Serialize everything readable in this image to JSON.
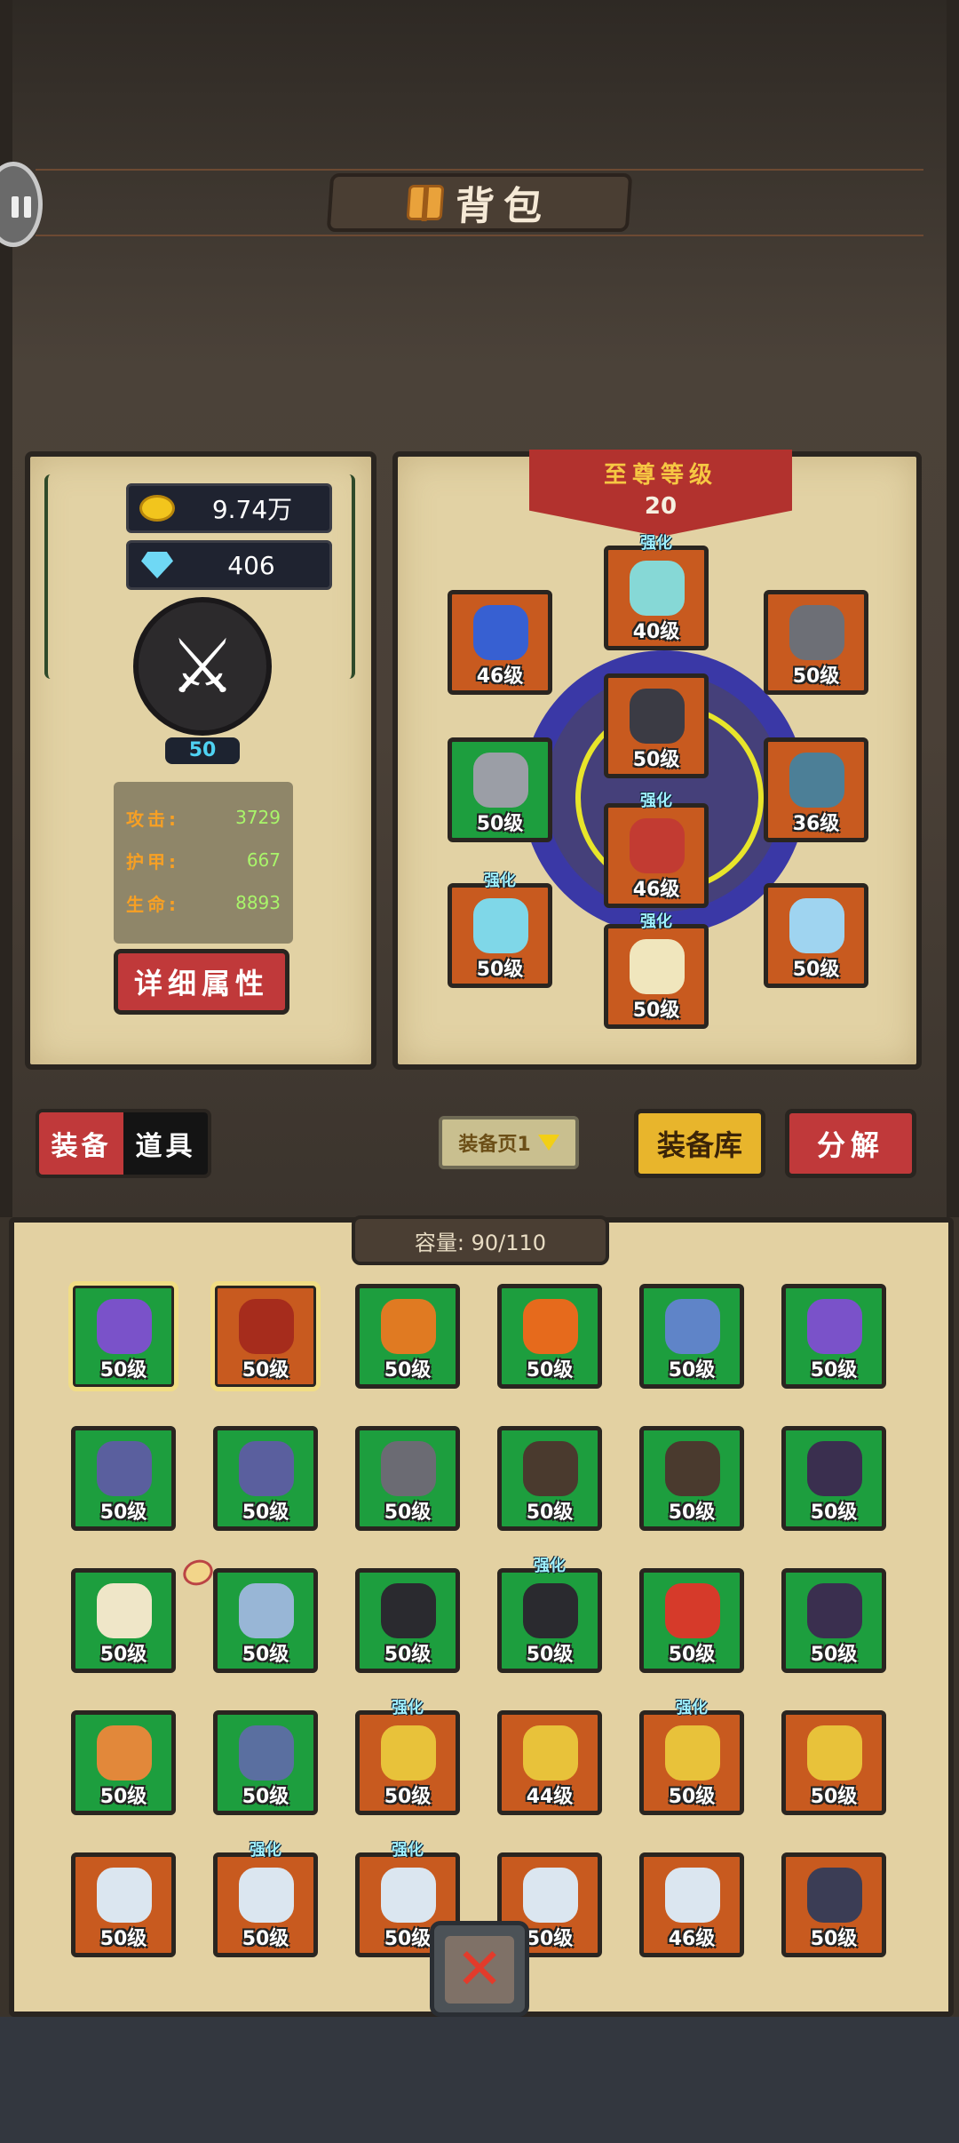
{
  "header": {
    "title": "背包"
  },
  "currency": {
    "gold": "9.74万",
    "gems": "406"
  },
  "hero": {
    "level": "50",
    "stats": [
      {
        "label": "攻击:",
        "value": "3729"
      },
      {
        "label": "护甲:",
        "value": "667"
      },
      {
        "label": "生命:",
        "value": "8893"
      }
    ],
    "detail_button": "详细属性"
  },
  "rank": {
    "title": "至尊等级",
    "level": "20"
  },
  "enhanced_label": "强化",
  "equipped": [
    {
      "slot": "helmet",
      "level": "40级",
      "color": "orange",
      "enhanced": true,
      "icon_color": "#86d8d6"
    },
    {
      "slot": "ring-left",
      "level": "46级",
      "color": "orange",
      "enhanced": false,
      "icon_color": "#3760d2"
    },
    {
      "slot": "necklace",
      "level": "50级",
      "color": "orange",
      "enhanced": false,
      "icon_color": "#6d6f76"
    },
    {
      "slot": "armor",
      "level": "50级",
      "color": "orange",
      "enhanced": false,
      "icon_color": "#3b3b44"
    },
    {
      "slot": "gloves",
      "level": "50级",
      "color": "green",
      "enhanced": false,
      "icon_color": "#9b9ea6"
    },
    {
      "slot": "bracelet",
      "level": "36级",
      "color": "orange",
      "enhanced": false,
      "icon_color": "#4c7f97"
    },
    {
      "slot": "belt",
      "level": "46级",
      "color": "orange",
      "enhanced": true,
      "icon_color": "#c23b32"
    },
    {
      "slot": "weapon-left",
      "level": "50级",
      "color": "orange",
      "enhanced": true,
      "icon_color": "#7fd7e8"
    },
    {
      "slot": "weapon-right",
      "level": "50级",
      "color": "orange",
      "enhanced": false,
      "icon_color": "#9fd4f0"
    },
    {
      "slot": "boots",
      "level": "50级",
      "color": "orange",
      "enhanced": true,
      "icon_color": "#f0e6bd"
    }
  ],
  "tabs": {
    "equipment": "装备",
    "items": "道具"
  },
  "page_select": "装备页1",
  "buttons": {
    "warehouse": "装备库",
    "decompose": "分解"
  },
  "capacity": "容量: 90/110",
  "inventory": [
    {
      "level": "50级",
      "color": "green",
      "enhanced": false,
      "selected": true,
      "icon_color": "#7a52c9"
    },
    {
      "level": "50级",
      "color": "orange",
      "enhanced": false,
      "selected": true,
      "icon_color": "#a62c1c"
    },
    {
      "level": "50级",
      "color": "green",
      "enhanced": false,
      "selected": false,
      "icon_color": "#e07a22"
    },
    {
      "level": "50级",
      "color": "green",
      "enhanced": false,
      "selected": false,
      "icon_color": "#e66a1c"
    },
    {
      "level": "50级",
      "color": "green",
      "enhanced": false,
      "selected": false,
      "icon_color": "#5f84c8"
    },
    {
      "level": "50级",
      "color": "green",
      "enhanced": false,
      "selected": false,
      "icon_color": "#7a52c9"
    },
    {
      "level": "50级",
      "color": "green",
      "enhanced": false,
      "selected": false,
      "icon_color": "#5a5f9e"
    },
    {
      "level": "50级",
      "color": "green",
      "enhanced": false,
      "selected": false,
      "icon_color": "#5a5f9e"
    },
    {
      "level": "50级",
      "color": "green",
      "enhanced": false,
      "selected": false,
      "icon_color": "#6b6b73"
    },
    {
      "level": "50级",
      "color": "green",
      "enhanced": false,
      "selected": false,
      "icon_color": "#4a3a2e"
    },
    {
      "level": "50级",
      "color": "green",
      "enhanced": false,
      "selected": false,
      "icon_color": "#4a3a2e"
    },
    {
      "level": "50级",
      "color": "green",
      "enhanced": false,
      "selected": false,
      "icon_color": "#3a2f4f"
    },
    {
      "level": "50级",
      "color": "green",
      "enhanced": false,
      "selected": false,
      "icon_color": "#efe6c8"
    },
    {
      "level": "50级",
      "color": "green",
      "enhanced": false,
      "selected": false,
      "icon_color": "#98b6d6"
    },
    {
      "level": "50级",
      "color": "green",
      "enhanced": false,
      "selected": false,
      "icon_color": "#2a2a2f"
    },
    {
      "level": "50级",
      "color": "green",
      "enhanced": true,
      "selected": false,
      "icon_color": "#2a2a2f"
    },
    {
      "level": "50级",
      "color": "green",
      "enhanced": false,
      "selected": false,
      "icon_color": "#d63a2a"
    },
    {
      "level": "50级",
      "color": "green",
      "enhanced": false,
      "selected": false,
      "icon_color": "#3a2f4f"
    },
    {
      "level": "50级",
      "color": "green",
      "enhanced": false,
      "selected": false,
      "icon_color": "#e2883a"
    },
    {
      "level": "50级",
      "color": "green",
      "enhanced": false,
      "selected": false,
      "icon_color": "#5a6fa0"
    },
    {
      "level": "50级",
      "color": "orange",
      "enhanced": true,
      "selected": false,
      "icon_color": "#e8c23a"
    },
    {
      "level": "44级",
      "color": "orange",
      "enhanced": false,
      "selected": false,
      "icon_color": "#e8c23a"
    },
    {
      "level": "50级",
      "color": "orange",
      "enhanced": true,
      "selected": false,
      "icon_color": "#e8c23a"
    },
    {
      "level": "50级",
      "color": "orange",
      "enhanced": false,
      "selected": false,
      "icon_color": "#e8c23a"
    },
    {
      "level": "50级",
      "color": "orange",
      "enhanced": false,
      "selected": false,
      "icon_color": "#dbe6f0"
    },
    {
      "level": "50级",
      "color": "orange",
      "enhanced": true,
      "selected": false,
      "icon_color": "#dbe6f0"
    },
    {
      "level": "50级",
      "color": "orange",
      "enhanced": true,
      "selected": false,
      "icon_color": "#dbe6f0"
    },
    {
      "level": "50级",
      "color": "orange",
      "enhanced": false,
      "selected": false,
      "icon_color": "#dbe6f0"
    },
    {
      "level": "46级",
      "color": "orange",
      "enhanced": false,
      "selected": false,
      "icon_color": "#dbe6f0"
    },
    {
      "level": "50级",
      "color": "orange",
      "enhanced": false,
      "selected": false,
      "icon_color": "#3b3d55"
    }
  ],
  "close_button": "✕"
}
